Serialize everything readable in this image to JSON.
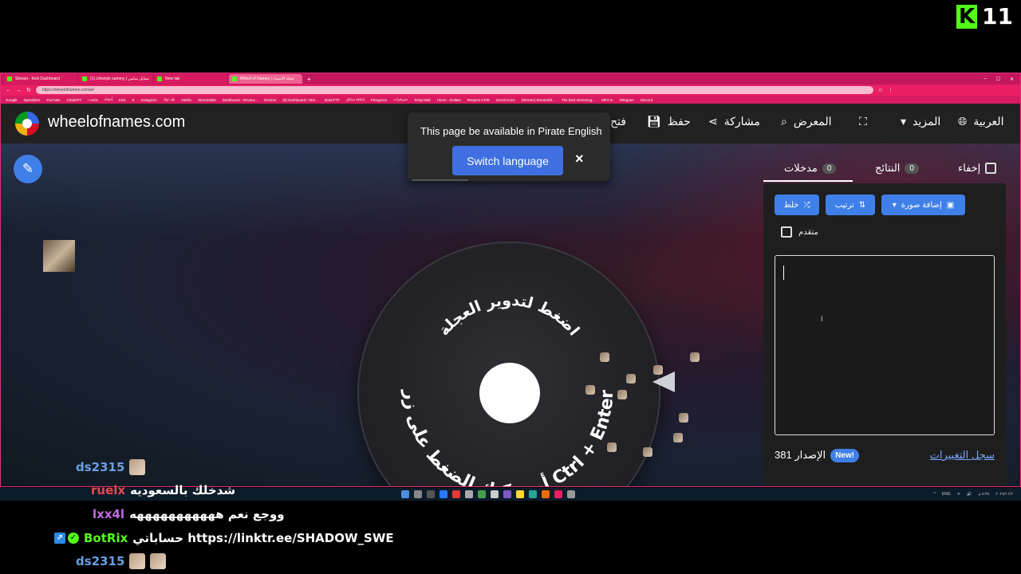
{
  "overlay": {
    "kick_logo": "K",
    "viewer_count": "11"
  },
  "browser": {
    "tabs": [
      {
        "label": "Stream - Kick Dashboard"
      },
      {
        "label": "(1) Lifestyle sammy | ستايل سامي"
      },
      {
        "label": "New tab"
      },
      {
        "label": "Wheel of Names | عجلة الأسماء"
      }
    ],
    "new_tab_symbol": "+",
    "window_controls": [
      "–",
      "☐",
      "✕"
    ],
    "url": "https://wheelofnames.com/ar/",
    "bookmarks": [
      "Google",
      "Speedtest",
      "YouTube",
      "ChatGPT",
      "يوتيوب",
      "أنشاء",
      "Kick",
      "X",
      "Instagram",
      "تيك توك",
      "Netflix",
      "Streamlabs",
      "Dashboard - Review...",
      "9Anime",
      "(9) Dashboard / Stre...",
      "DoksTTP",
      "إضافة ستايل",
      "Pinegrove",
      "سيرفرات",
      "Temp Mail",
      "Home - Outlaw",
      "Respect CFW",
      "Social icons",
      "(Stream) StreamElt...",
      "The best streaming...",
      "MP3 to",
      "Telegram",
      "Discord"
    ]
  },
  "site": {
    "name": "wheelofnames.com",
    "menu": {
      "open": "فتح",
      "save": "حفظ",
      "share": "مشاركة",
      "gallery": "المعرض",
      "more": "المزيد",
      "language": "العربية"
    },
    "icons": {
      "save": "floppy-icon",
      "share": "share-icon",
      "gallery": "search-icon",
      "fullscreen": "fullscreen-icon",
      "more": "caret-down-icon",
      "language": "globe-icon"
    }
  },
  "wheel": {
    "top_text": "اضغط لتدوير العجلة",
    "bottom_text": "أو يمكنك الضغط على زر Ctrl + Enter"
  },
  "panel": {
    "tabs": {
      "entries_label": "مدخلات",
      "entries_count": "0",
      "results_label": "النتائج",
      "results_count": "0",
      "hide_label": "إخفاء"
    },
    "buttons": {
      "shuffle": "خلط",
      "sort": "ترتيب",
      "add_image": "إضافة صورة"
    },
    "advanced_label": "متقدم",
    "entries_value": "",
    "ibeam": "I",
    "version_label": "الإصدار 381",
    "new_badge": "New!",
    "changelog_link": "سجل التغييرات"
  },
  "popup": {
    "message": "This page be available in Pirate English",
    "switch_button": "Switch language",
    "close": "×"
  },
  "taskbar": {
    "tray": [
      "^",
      "ENG",
      "ᯤ",
      "🔊",
      "٤:٣٤ م",
      "٢٠٢٤/١١/٢"
    ]
  },
  "chat": {
    "messages": [
      {
        "user": "ds2315",
        "color": "#6aa0e0",
        "text": ""
      },
      {
        "user": "ruelx",
        "color": "#e84a4a",
        "text": "شدخلك بالسعوديه"
      },
      {
        "user": "lxx4l",
        "color": "#c06ae0",
        "text": "ووجع نعم هههههههههههه"
      },
      {
        "user": "BotRix",
        "color": "#53fc18",
        "text": "حساباتي https://linktr.ee/SHADOW_SWE"
      },
      {
        "user": "ds2315",
        "color": "#6aa0e0",
        "text": ""
      }
    ]
  },
  "colors": {
    "accent": "#3f7fe8",
    "kick_green": "#53fc18",
    "browser_frame": "#cc1f6a"
  }
}
